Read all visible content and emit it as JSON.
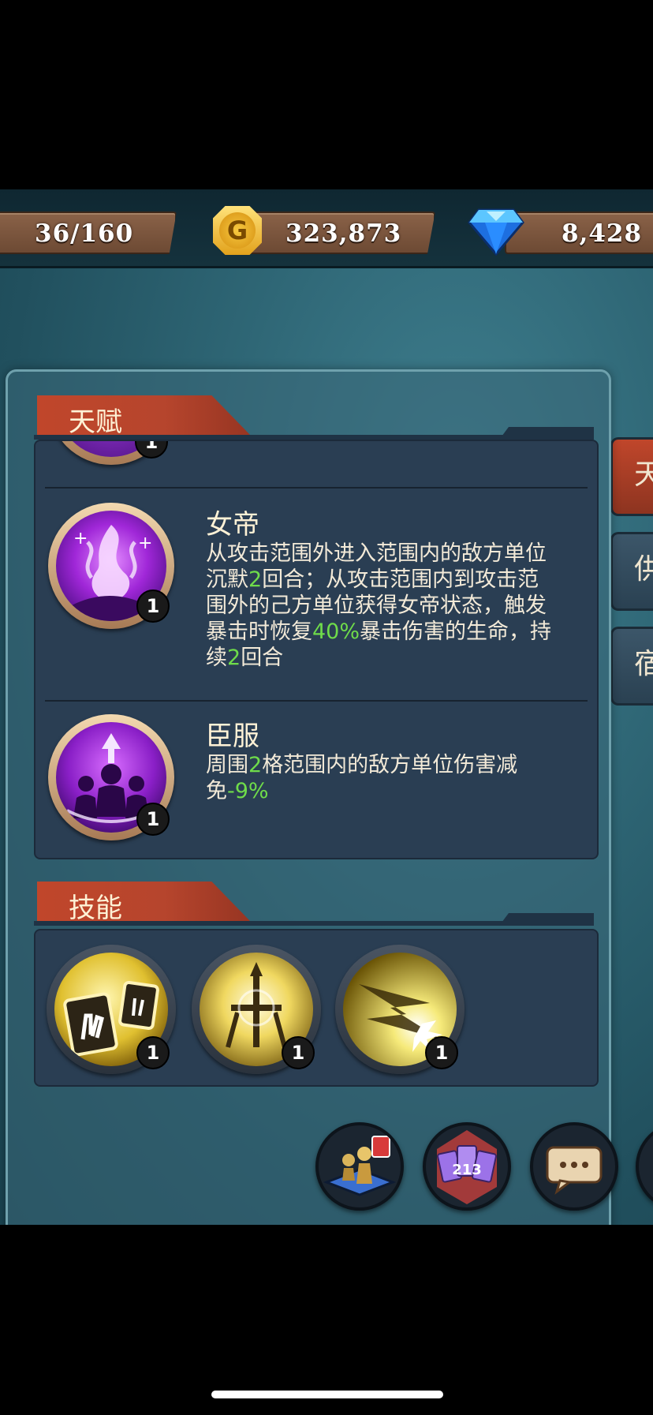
{
  "resources": {
    "stamina": "36/160",
    "gold": "323,873",
    "gems": "8,428",
    "gold_icon_letter": "G"
  },
  "sections": {
    "talent_title": "天赋",
    "skill_title": "技能"
  },
  "talents": [
    {
      "icon": "empress-flame-icon",
      "level": "1",
      "name": "女帝",
      "desc": [
        {
          "t": "从攻击范围外进入范围内的敌方单位沉默",
          "hl": false
        },
        {
          "t": "2",
          "hl": true
        },
        {
          "t": "回合；从攻击范围内到攻击范围外的己方单位获得女帝状态，触发暴击时恢复",
          "hl": false
        },
        {
          "t": "40%",
          "hl": true
        },
        {
          "t": "暴击伤害的生命，持续",
          "hl": false
        },
        {
          "t": "2",
          "hl": true
        },
        {
          "t": "回合",
          "hl": false
        }
      ]
    },
    {
      "icon": "submission-crowd-icon",
      "level": "1",
      "name": "臣服",
      "desc": [
        {
          "t": "周围",
          "hl": false
        },
        {
          "t": "2",
          "hl": true
        },
        {
          "t": "格范围内的敌方单位伤害减免",
          "hl": false
        },
        {
          "t": "-9%",
          "hl": true
        }
      ]
    }
  ],
  "partial_talent_level": "1",
  "skills": [
    {
      "icon": "hand-cards-icon",
      "level": "1"
    },
    {
      "icon": "sword-burst-icon",
      "level": "1"
    },
    {
      "icon": "lightning-slash-icon",
      "level": "1"
    }
  ],
  "side_tabs": [
    "天",
    "供",
    "宿"
  ],
  "bottom_buttons": [
    "chess-pieces-icon",
    "number-cards-icon",
    "chat-bubble-icon"
  ],
  "bottom_cards_text": "213",
  "colors": {
    "highlight": "#6fdc4a",
    "header_red": "#c0462b",
    "box_bg": "#2a3e53"
  }
}
